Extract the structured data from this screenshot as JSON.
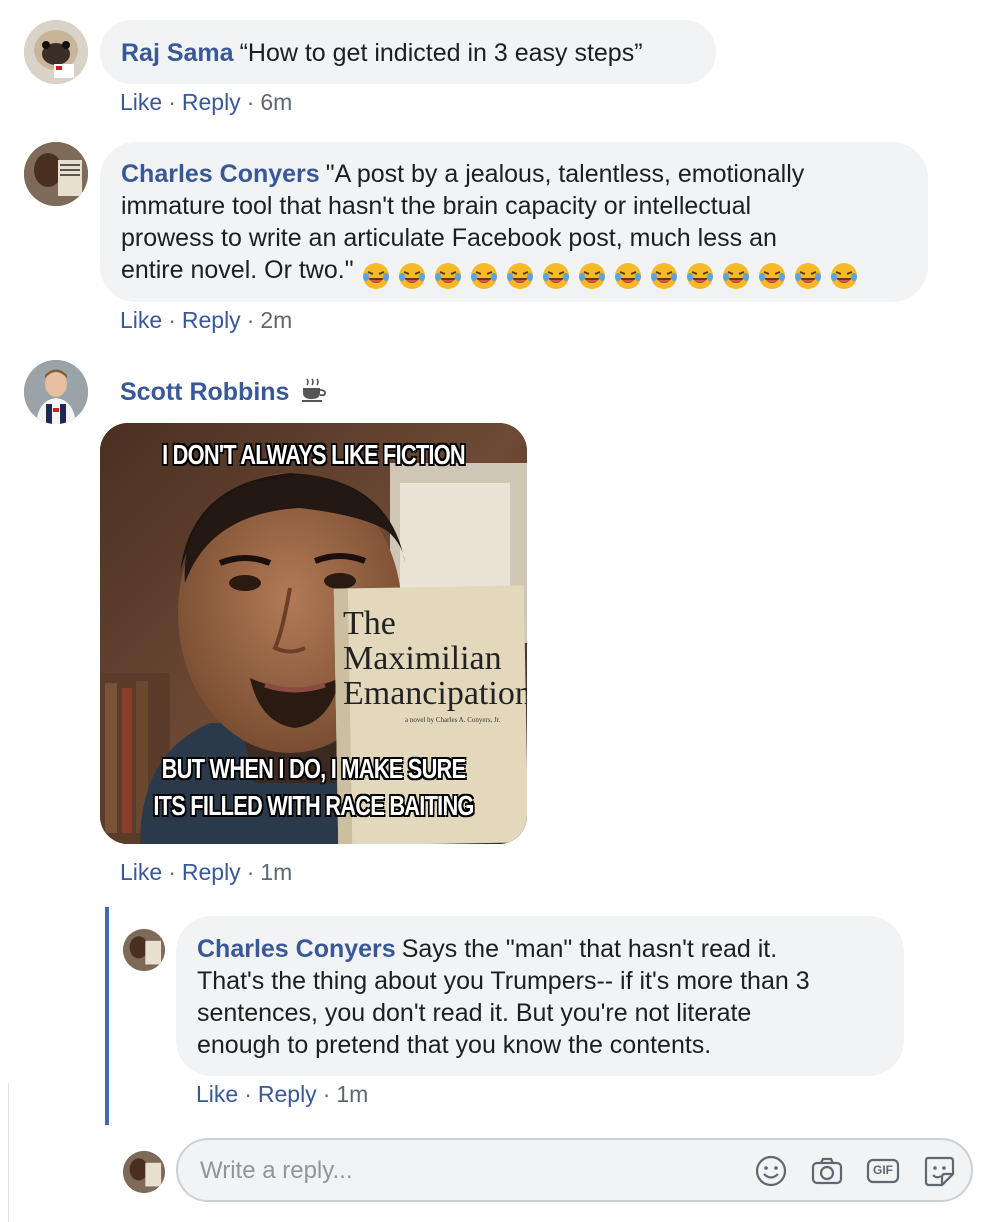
{
  "comments": [
    {
      "author": "Raj Sama",
      "text": "“How to get indicted in 3 easy steps”",
      "like": "Like",
      "reply": "Reply",
      "time": "6m"
    },
    {
      "author": "Charles Conyers",
      "text_lines": [
        "\"A post by a jealous, talentless, emotionally",
        "immature tool that hasn't the brain capacity or intellectual",
        "prowess to write an articulate Facebook post, much less an",
        "entire novel. Or two.\""
      ],
      "emoji_name": "rolling-on-floor-laughing-emoji",
      "emoji_count": 14,
      "like": "Like",
      "reply": "Reply",
      "time": "2m"
    },
    {
      "author": "Scott Robbins",
      "badge_icon": "coffee-cup-icon",
      "meme": {
        "top_text": "I DON'T ALWAYS LIKE FICTION",
        "book_line1": "The",
        "book_line2": "Maximilian",
        "book_line3": "Emancipation",
        "book_byline": "a novel by Charles A. Conyers, Jr.",
        "bottom_text1": "BUT WHEN I DO, I MAKE SURE",
        "bottom_text2": "ITS FILLED WITH RACE BAITING"
      },
      "like": "Like",
      "reply": "Reply",
      "time": "1m"
    }
  ],
  "nested_reply": {
    "author": "Charles Conyers",
    "text_lines": [
      "Says the \"man\" that hasn't read it.",
      "That's the thing about you Trumpers-- if it's more than 3",
      "sentences, you don't read it. But you're not literate",
      "enough to pretend that you know the contents."
    ],
    "like": "Like",
    "reply": "Reply",
    "time": "1m"
  },
  "reply_box": {
    "placeholder": "Write a reply...",
    "icons": [
      "emoji-icon",
      "camera-icon",
      "gif-icon",
      "sticker-icon"
    ],
    "gif_label": "GIF"
  },
  "colors": {
    "link": "#385898",
    "bubble": "#f2f3f5",
    "thread_line": "#4267b2",
    "meta": "#616770"
  }
}
